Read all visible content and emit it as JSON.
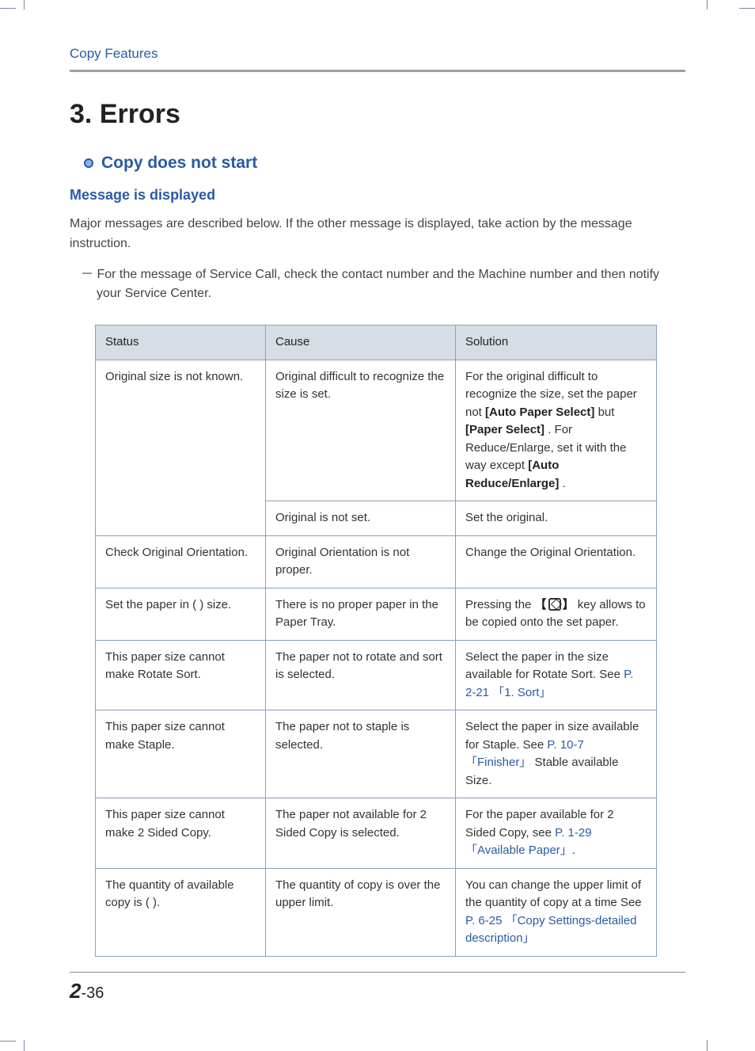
{
  "header": {
    "running": "Copy Features"
  },
  "chapter": {
    "num": "3",
    "title": "Errors"
  },
  "section": {
    "bullet": "Copy does not start",
    "sub": "Message is displayed"
  },
  "intro": "Major messages are described below. If the other message is displayed, take action by the message instruction.",
  "note": "－ For the message of Service Call, check the contact number and the Machine number and then notify your Service Center.",
  "table": {
    "headers": {
      "status": "Status",
      "cause": "Cause",
      "solution": "Solution"
    },
    "rows": [
      {
        "status": "Original size is not known.",
        "cause": "Original difficult to recognize the size is set.",
        "solution_pre": "For the original difficult to recognize the size, set the paper not ",
        "bold1": "[Auto Paper Select]",
        "mid1": " but ",
        "bold2": "[Paper Select]",
        "mid2": ". For Reduce/Enlarge, set it with the way except ",
        "bold3": "[Auto Reduce/Enlarge]",
        "tail": "."
      },
      {
        "status": "",
        "cause": "Original is not set.",
        "solution": "Set the original."
      },
      {
        "status": "Check Original Orientation.",
        "cause": "Original Orientation is not proper.",
        "solution": "Change the Original Orientation."
      },
      {
        "status": "Set the paper in ( ) size.",
        "cause": "There is no proper paper in the Paper Tray.",
        "sol_pre": "Pressing the ",
        "sol_post": " key allows to be copied onto the set paper."
      },
      {
        "status": "This paper size cannot make Rotate Sort.",
        "cause": "The paper not to rotate and sort is selected.",
        "sol_pre": "Select the paper in the size available for Rotate Sort. See ",
        "link": "P. 2-21 「1. Sort」"
      },
      {
        "status": "This paper size cannot make Staple.",
        "cause": "The paper not to staple is selected.",
        "sol_pre": "Select the paper in size available for Staple. See ",
        "link": "P. 10-7 「Finisher」",
        "sol_post": " Stable available Size."
      },
      {
        "status": "This paper size cannot make 2 Sided Copy.",
        "cause": "The paper not available for 2 Sided Copy is selected.",
        "sol_pre": "For the paper available for 2 Sided Copy, see ",
        "link": "P. 1-29 「Available Paper」",
        "sol_post": "."
      },
      {
        "status": "The quantity of available copy is (  ).",
        "cause": "The quantity of copy is over the upper limit.",
        "sol_pre": "You can change the upper limit of the quantity of copy at a time See ",
        "link": "P. 6-25 「Copy Settings-detailed description」"
      }
    ]
  },
  "footer": {
    "chapter": "2",
    "page": "-36"
  }
}
